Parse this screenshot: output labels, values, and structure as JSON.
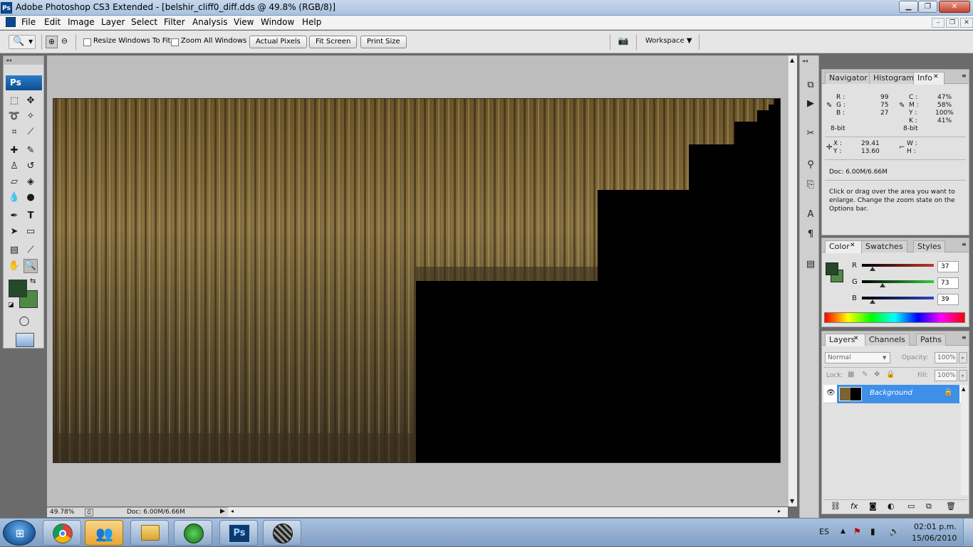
{
  "window": {
    "icon_label": "Ps",
    "title": "Adobe Photoshop CS3 Extended - [belshir_cliff0_diff.dds @ 49.8% (RGB/8)]",
    "controls": {
      "minimize": "▁",
      "maximize": "❐",
      "close": "✕"
    }
  },
  "menubar": {
    "items": [
      "File",
      "Edit",
      "Image",
      "Layer",
      "Select",
      "Filter",
      "Analysis",
      "View",
      "Window",
      "Help"
    ],
    "doc_controls": {
      "minimize": "–",
      "restore": "❐",
      "close": "✕"
    }
  },
  "options": {
    "resize_windows_label": "Resize Windows To Fit",
    "zoom_all_label": "Zoom All Windows",
    "actual_pixels": "Actual Pixels",
    "fit_screen": "Fit Screen",
    "print_size": "Print Size",
    "workspace": "Workspace ▼"
  },
  "toolbox": {
    "collapse": "◂◂",
    "logo": "Ps",
    "foreground_color": "#25492b",
    "background_color": "#4f8a45"
  },
  "status": {
    "zoom": "49.78%",
    "doc": "Doc: 6.00M/6.66M"
  },
  "navigator_panel": {
    "tabs": [
      "Navigator",
      "Histogram",
      "Info"
    ],
    "active_tab": "Info",
    "rgb": {
      "R": "99",
      "G": "75",
      "B": "27"
    },
    "cmyk": {
      "C": "47%",
      "M": "58%",
      "Y": "100%",
      "K": "41%"
    },
    "bit_depth_left": "8-bit",
    "bit_depth_right": "8-bit",
    "x": "29.41",
    "y": "13.60",
    "w": "",
    "h": "",
    "doc": "Doc: 6.00M/6.66M",
    "hint": "Click or drag over the area you want to enlarge. Change the zoom state on the Options bar."
  },
  "color_panel": {
    "tabs": [
      "Color",
      "Swatches",
      "Styles"
    ],
    "active_tab": "Color",
    "channels": [
      {
        "label": "R",
        "value": "37",
        "fraction": 0.145,
        "color": "#c0392b"
      },
      {
        "label": "G",
        "value": "73",
        "fraction": 0.286,
        "color": "#2ecc40"
      },
      {
        "label": "B",
        "value": "39",
        "fraction": 0.153,
        "color": "#2c47c6"
      }
    ],
    "foreground": "#25492b",
    "background": "#4f8a45"
  },
  "layers_panel": {
    "tabs": [
      "Layers",
      "Channels",
      "Paths"
    ],
    "active_tab": "Layers",
    "blend_mode": "Normal",
    "opacity_label": "Opacity:",
    "opacity": "100%",
    "lock_label": "Lock:",
    "fill_label": "Fill:",
    "fill": "100%",
    "layers": [
      {
        "name": "Background",
        "selected": true
      }
    ],
    "footer_icons": [
      "link-icon",
      "fx-icon",
      "mask-icon",
      "adjustment-icon",
      "folder-icon",
      "new-layer-icon",
      "trash-icon"
    ]
  },
  "taskbar": {
    "language": "ES",
    "time": "02:01 p.m.",
    "date": "15/06/2010",
    "apps": [
      "chrome",
      "messenger",
      "explorer",
      "app-green",
      "photoshop",
      "app-sphere"
    ]
  }
}
